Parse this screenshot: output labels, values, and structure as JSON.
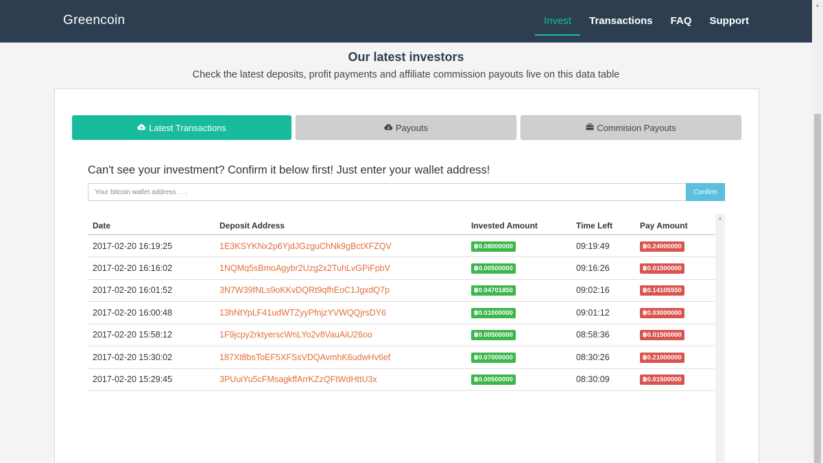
{
  "navbar": {
    "brand": "Greencoin",
    "items": [
      {
        "label": "Invest",
        "active": true
      },
      {
        "label": "Transactions",
        "active": false
      },
      {
        "label": "FAQ",
        "active": false
      },
      {
        "label": "Support",
        "active": false
      }
    ]
  },
  "section": {
    "title": "Our latest investors",
    "subtitle": "Check the latest deposits, profit payments and affiliate commission payouts live on this data table"
  },
  "tabs": {
    "latest": {
      "label": "Latest Transactions",
      "icon": "cloud-upload-icon"
    },
    "payouts": {
      "label": "Payouts",
      "icon": "cloud-download-icon"
    },
    "commission": {
      "label": "Commision Payouts",
      "icon": "briefcase-icon"
    }
  },
  "confirm_box": {
    "prompt": "Can't see your investment? Confirm it below first! Just enter your wallet address!",
    "placeholder": "Your bitcoin wallet address . . .",
    "value": "",
    "button_label": "Confirm"
  },
  "table": {
    "headers": {
      "date": "Date",
      "address": "Deposit Address",
      "invested": "Invested Amount",
      "time_left": "Time Left",
      "pay": "Pay Amount"
    },
    "rows": [
      {
        "date": "2017-02-20 16:19:25",
        "address": "1E3KSYKNx2p6YjdJGzguChNk9gBctXFZQV",
        "invested": "฿0.08000000",
        "time_left": "09:19:49",
        "pay": "฿0.24000000"
      },
      {
        "date": "2017-02-20 16:16:02",
        "address": "1NQMq5sBmoAgybr2Uzg2x2TuhLvGPiFpbV",
        "invested": "฿0.00500000",
        "time_left": "09:16:26",
        "pay": "฿0.01500000"
      },
      {
        "date": "2017-02-20 16:01:52",
        "address": "3N7W39fNLs9oKKvDQRt9qfhEoC1JgxdQ7p",
        "invested": "฿0.04701850",
        "time_left": "09:02:16",
        "pay": "฿0.14105550"
      },
      {
        "date": "2017-02-20 16:00:48",
        "address": "13hNtYpLF41udWTZyyPfnjzYVWQQjrsDY6",
        "invested": "฿0.01000000",
        "time_left": "09:01:12",
        "pay": "฿0.03000000"
      },
      {
        "date": "2017-02-20 15:58:12",
        "address": "1F9jcpy2rktyerscWnLYo2v8VauAiU26oo",
        "invested": "฿0.00500000",
        "time_left": "08:58:36",
        "pay": "฿0.01500000"
      },
      {
        "date": "2017-02-20 15:30:02",
        "address": "187Xt8bsToEF5XFSsVDQAvmhK6udwHv6ef",
        "invested": "฿0.07000000",
        "time_left": "08:30:26",
        "pay": "฿0.21000000"
      },
      {
        "date": "2017-02-20 15:29:45",
        "address": "3PUuiYu5cFMsagkffArrKZzQFtWdHttU3x",
        "invested": "฿0.00500000",
        "time_left": "08:30:09",
        "pay": "฿0.01500000"
      }
    ]
  },
  "colors": {
    "navbar": "#2c3e50",
    "accent": "#18bc9c",
    "address": "#e36f3c",
    "badge_green": "#3cb64a",
    "badge_red": "#d9534f",
    "confirm": "#5bc0de"
  }
}
